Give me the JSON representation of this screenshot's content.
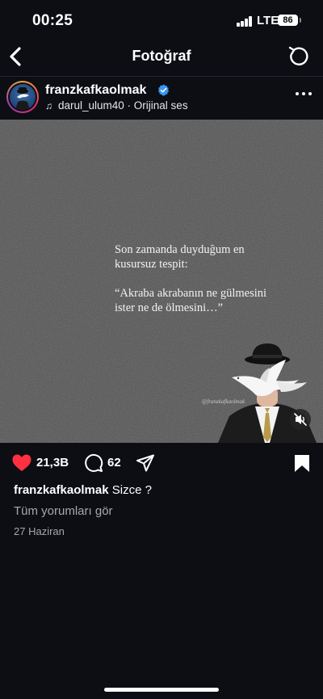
{
  "status_bar": {
    "time": "00:25",
    "network": "LTE",
    "battery": "86"
  },
  "nav": {
    "title": "Fotoğraf"
  },
  "post": {
    "username": "franzkafkaolmak",
    "audio": "darul_ulum40 · Orijinal ses",
    "image_text": {
      "line1": "Son zamanda duyduğum en",
      "line2": "kusursuz tespit:",
      "line3": "“Akraba akrabanın ne gülmesini",
      "line4": "ister ne de ölmesini…”",
      "watermark": "@franzkafkaolmak"
    },
    "likes": "21,3B",
    "comments": "62",
    "caption_user": "franzkafkaolmak",
    "caption_text": "Sizce ?",
    "view_comments": "Tüm yorumları gör",
    "date": "27 Haziran"
  },
  "colors": {
    "like": "#ff3040",
    "verified": "#3897f0",
    "background": "#0c0e14"
  }
}
